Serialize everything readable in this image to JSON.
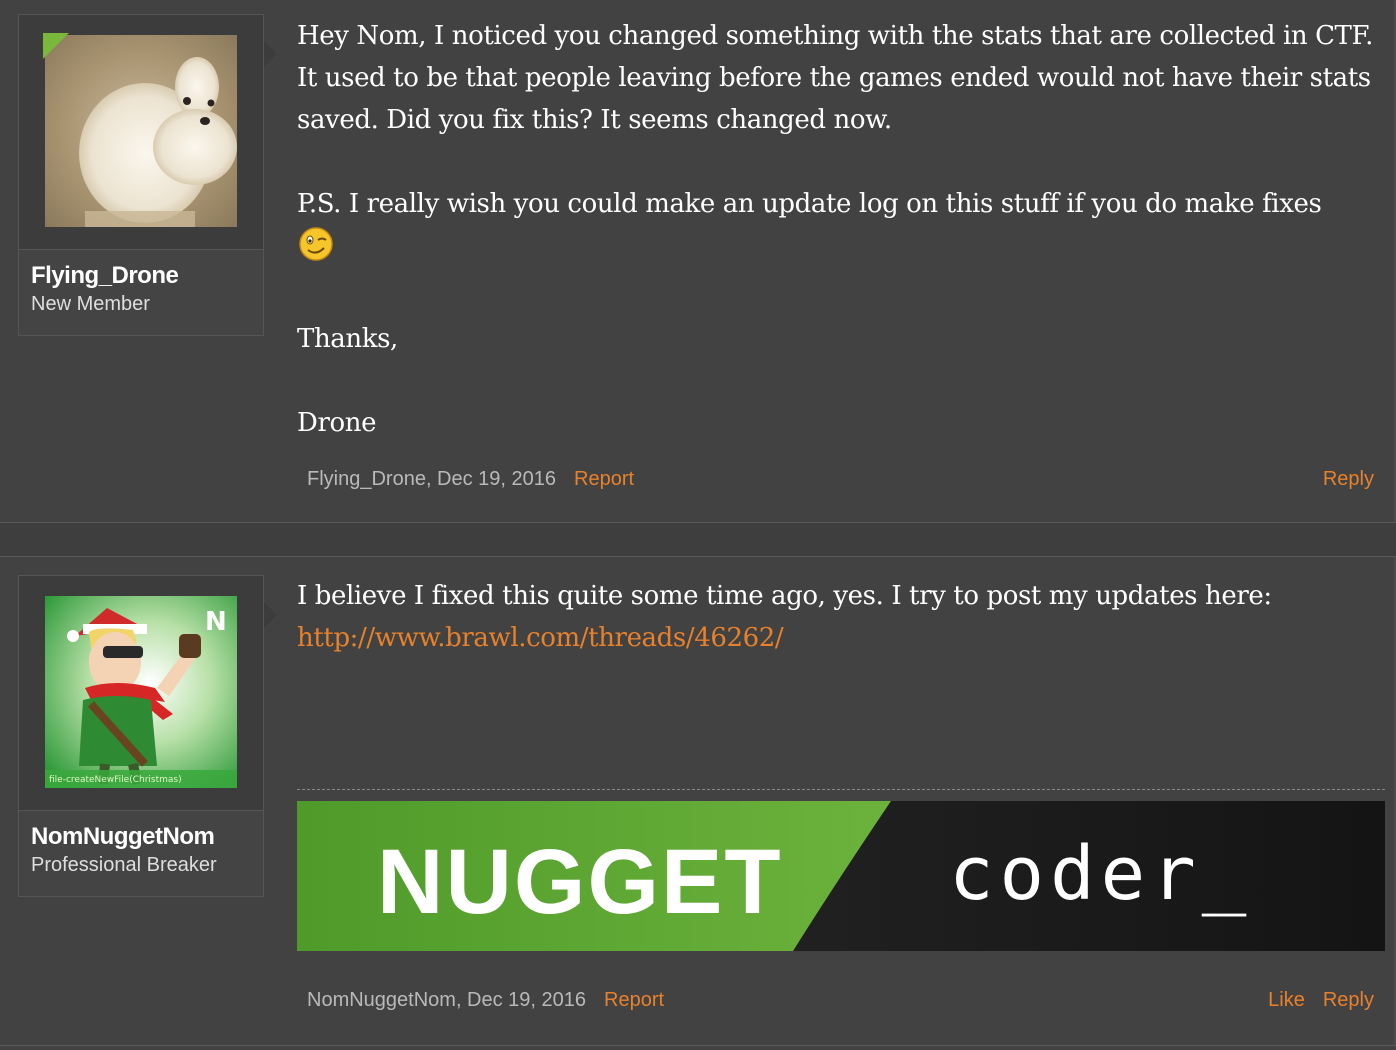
{
  "posts": [
    {
      "username": "Flying_Drone",
      "user_title": "New Member",
      "avatar_icon": "dog-avatar",
      "message": {
        "p1": "Hey Nom, I noticed you changed something with the stats that are collected in CTF. It used to be that people leaving before the games ended would not have their stats saved. Did you fix this? It seems changed now.",
        "p2": "P.S. I really wish you could make an update log on this stuff if you do make fixes",
        "p3": "Thanks,",
        "p4": "Drone"
      },
      "meta": {
        "author_date": "Flying_Drone, Dec 19, 2016",
        "report": "Report"
      },
      "actions": {
        "reply": "Reply"
      }
    },
    {
      "username": "NomNuggetNom",
      "user_title": "Professional Breaker",
      "avatar_icon": "christmas-character-avatar",
      "avatar_caption": "file-createNewFile(Christmas)",
      "message": {
        "p1": "I believe I fixed this quite some time ago, yes. I try to post my updates here:",
        "link": "http://www.brawl.com/threads/46262/"
      },
      "signature": {
        "left_text": "NUGGET",
        "right_text": "coder_"
      },
      "meta": {
        "author_date": "NomNuggetNom, Dec 19, 2016",
        "report": "Report"
      },
      "actions": {
        "like": "Like",
        "reply": "Reply"
      }
    }
  ],
  "colors": {
    "accent": "#e8812b",
    "background": "#424242",
    "text": "#ffffff",
    "muted": "#b9b9b9"
  }
}
